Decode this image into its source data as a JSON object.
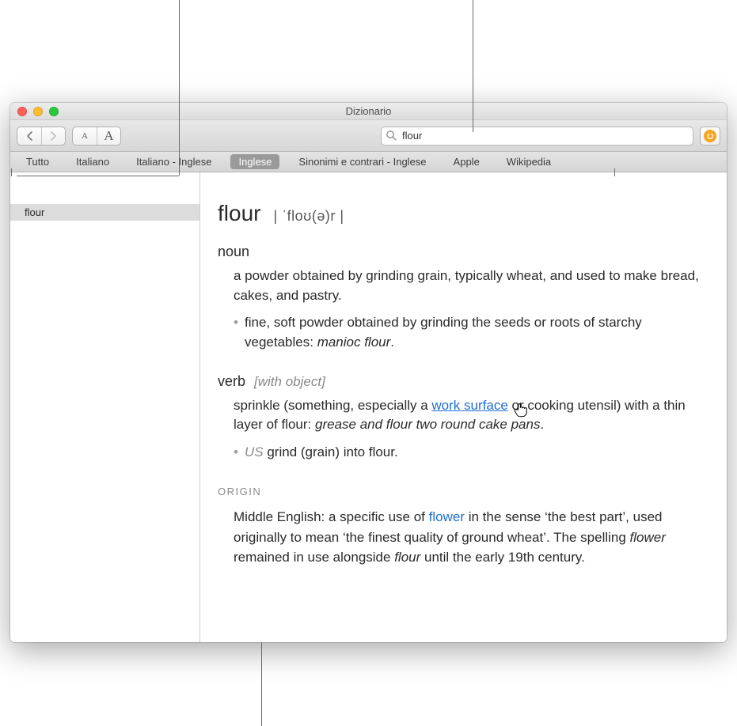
{
  "window": {
    "title": "Dizionario"
  },
  "toolbar": {
    "fontsize_small": "A",
    "fontsize_large": "A"
  },
  "search": {
    "value": "flour"
  },
  "sources": {
    "items": [
      {
        "label": "Tutto"
      },
      {
        "label": "Italiano"
      },
      {
        "label": "Italiano - Inglese"
      },
      {
        "label": "Inglese"
      },
      {
        "label": "Sinonimi e contrari - Inglese"
      },
      {
        "label": "Apple"
      },
      {
        "label": "Wikipedia"
      }
    ],
    "active_index": 3
  },
  "sidebar": {
    "items": [
      {
        "label": "flour"
      }
    ]
  },
  "entry": {
    "headword": "flour",
    "pronunciation": "| ˈfloʊ(ə)r |",
    "pos_noun": "noun",
    "noun_def": "a powder obtained by grinding grain, typically wheat, and used to make bread, cakes, and pastry.",
    "noun_sub_pre": "fine, soft powder obtained by grinding the seeds or roots of starchy vegetables: ",
    "noun_sub_ex": "manioc flour",
    "noun_sub_post": ".",
    "pos_verb": "verb",
    "verb_gram": "[with object]",
    "verb_def_pre": "sprinkle (something, especially a ",
    "verb_xref": "work surface",
    "verb_def_mid": " or cooking utensil) with a thin layer of flour: ",
    "verb_ex": "grease and flour two round cake pans",
    "verb_def_post": ".",
    "verb_sub_region": "US",
    "verb_sub_text": " grind (grain) into flour.",
    "origin_label": "ORIGIN",
    "origin_pre": "Middle English: a specific use of ",
    "origin_xref": "flower",
    "origin_mid1": " in the sense ‘the best part’, used originally to mean ‘the finest quality of ground wheat’. The spelling ",
    "origin_it1": "flower",
    "origin_mid2": " remained in use alongside ",
    "origin_it2": "flour",
    "origin_post": " until the early 19th century."
  }
}
